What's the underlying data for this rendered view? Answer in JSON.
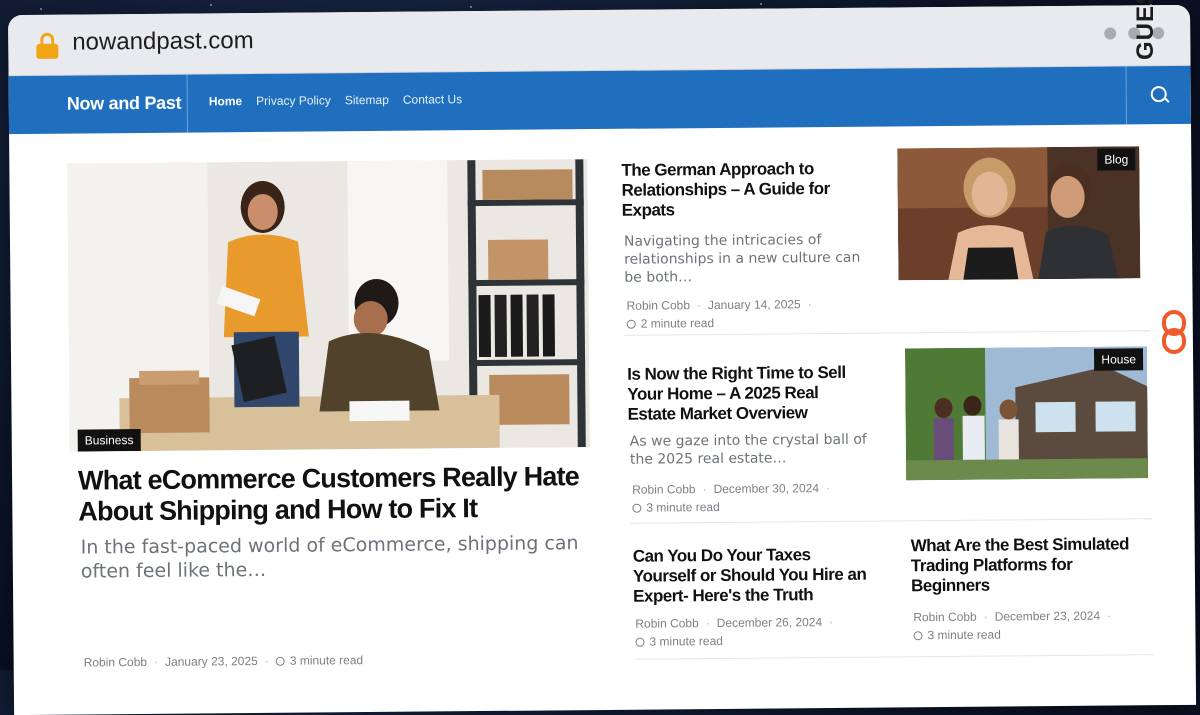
{
  "browser": {
    "url": "nowandpast.com"
  },
  "nav": {
    "brand": "Now and Past",
    "links": [
      "Home",
      "Privacy Policy",
      "Sitemap",
      "Contact Us"
    ]
  },
  "hero": {
    "category": "Business",
    "title": "What eCommerce Customers Really Hate About Shipping and How to Fix It",
    "excerpt": "In the fast-paced world of eCommerce, shipping can often feel like the…",
    "author": "Robin Cobb",
    "date": "January 23, 2025",
    "read_time": "3 minute read"
  },
  "articles": [
    {
      "title": "The German Approach to Relationships – A Guide for Expats",
      "excerpt": "Navigating the intricacies of relationships in a new culture can be both…",
      "author": "Robin Cobb",
      "date": "January 14, 2025",
      "read_time": "2 minute read",
      "category": "Blog"
    },
    {
      "title": "Is Now the Right Time to Sell Your Home – A 2025 Real Estate Market Overview",
      "excerpt": "As we gaze into the crystal ball of the 2025 real estate…",
      "author": "Robin Cobb",
      "date": "December 30, 2024",
      "read_time": "3 minute read",
      "category": "House"
    },
    {
      "title": "Can You Do Your Taxes Yourself or Should You Hire an Expert- Here's the Truth",
      "author": "Robin Cobb",
      "date": "December 26, 2024",
      "read_time": "3 minute read"
    },
    {
      "title": "What Are the Best Simulated Trading Platforms for Beginners",
      "author": "Robin Cobb",
      "date": "December 23, 2024",
      "read_time": "3 minute read"
    }
  ],
  "watermark": {
    "text": "GUESTPOSTLINKS"
  },
  "colors": {
    "nav_blue": "#1f6fbe",
    "lock_orange": "#f2a516",
    "watermark_accent": "#f05a28"
  }
}
